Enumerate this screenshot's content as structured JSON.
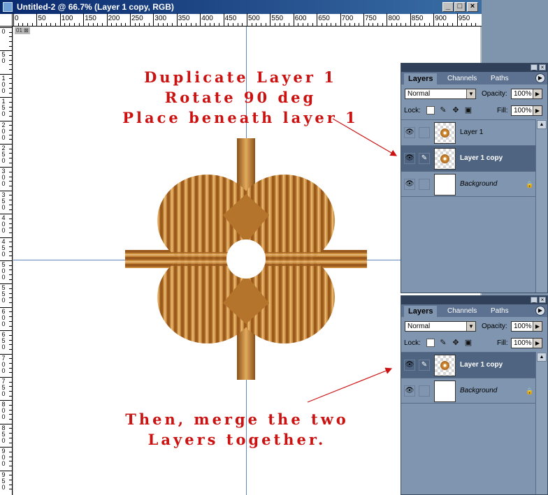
{
  "window": {
    "title": "Untitled-2 @ 66.7% (Layer 1 copy, RGB)"
  },
  "window_buttons": {
    "minimize": "_",
    "maximize": "□",
    "close": "×"
  },
  "ruler": {
    "h_labels": [
      "0",
      "50",
      "100",
      "150",
      "200",
      "250",
      "300",
      "350",
      "400",
      "450",
      "500",
      "550",
      "600",
      "650",
      "700",
      "750",
      "800",
      "850",
      "900",
      "950"
    ],
    "v_labels": [
      "0",
      "50",
      "100",
      "150",
      "200",
      "250",
      "300",
      "350",
      "400",
      "450",
      "500",
      "550",
      "600",
      "650",
      "700",
      "750",
      "800",
      "850",
      "900",
      "950"
    ]
  },
  "canvas": {
    "badge": "01 ⊠"
  },
  "annotations": {
    "top": [
      "Duplicate Layer 1",
      "Rotate 90 deg",
      "Place beneath layer 1"
    ],
    "bottom": [
      "Then, merge the two",
      "Layers together."
    ],
    "color": "#cc1111"
  },
  "palettes": [
    {
      "tabs": [
        "Layers",
        "Channels",
        "Paths"
      ],
      "blend_mode": "Normal",
      "opacity_label": "Opacity:",
      "opacity": "100%",
      "lock_label": "Lock:",
      "fill_label": "Fill:",
      "fill": "100%",
      "layers": [
        {
          "name": "Layer 1",
          "selected": false,
          "transparent": true
        },
        {
          "name": "Layer 1 copy",
          "selected": true,
          "transparent": true
        },
        {
          "name": "Background",
          "selected": false,
          "transparent": false,
          "locked": true
        }
      ]
    },
    {
      "tabs": [
        "Layers",
        "Channels",
        "Paths"
      ],
      "blend_mode": "Normal",
      "opacity_label": "Opacity:",
      "opacity": "100%",
      "lock_label": "Lock:",
      "fill_label": "Fill:",
      "fill": "100%",
      "layers": [
        {
          "name": "Layer 1 copy",
          "selected": true,
          "transparent": true
        },
        {
          "name": "Background",
          "selected": false,
          "transparent": false,
          "locked": true
        }
      ]
    }
  ],
  "icons": {
    "eye": "👁",
    "brush": "✎",
    "lock": "🔒",
    "menu": "▶",
    "dropdown": "▼"
  }
}
